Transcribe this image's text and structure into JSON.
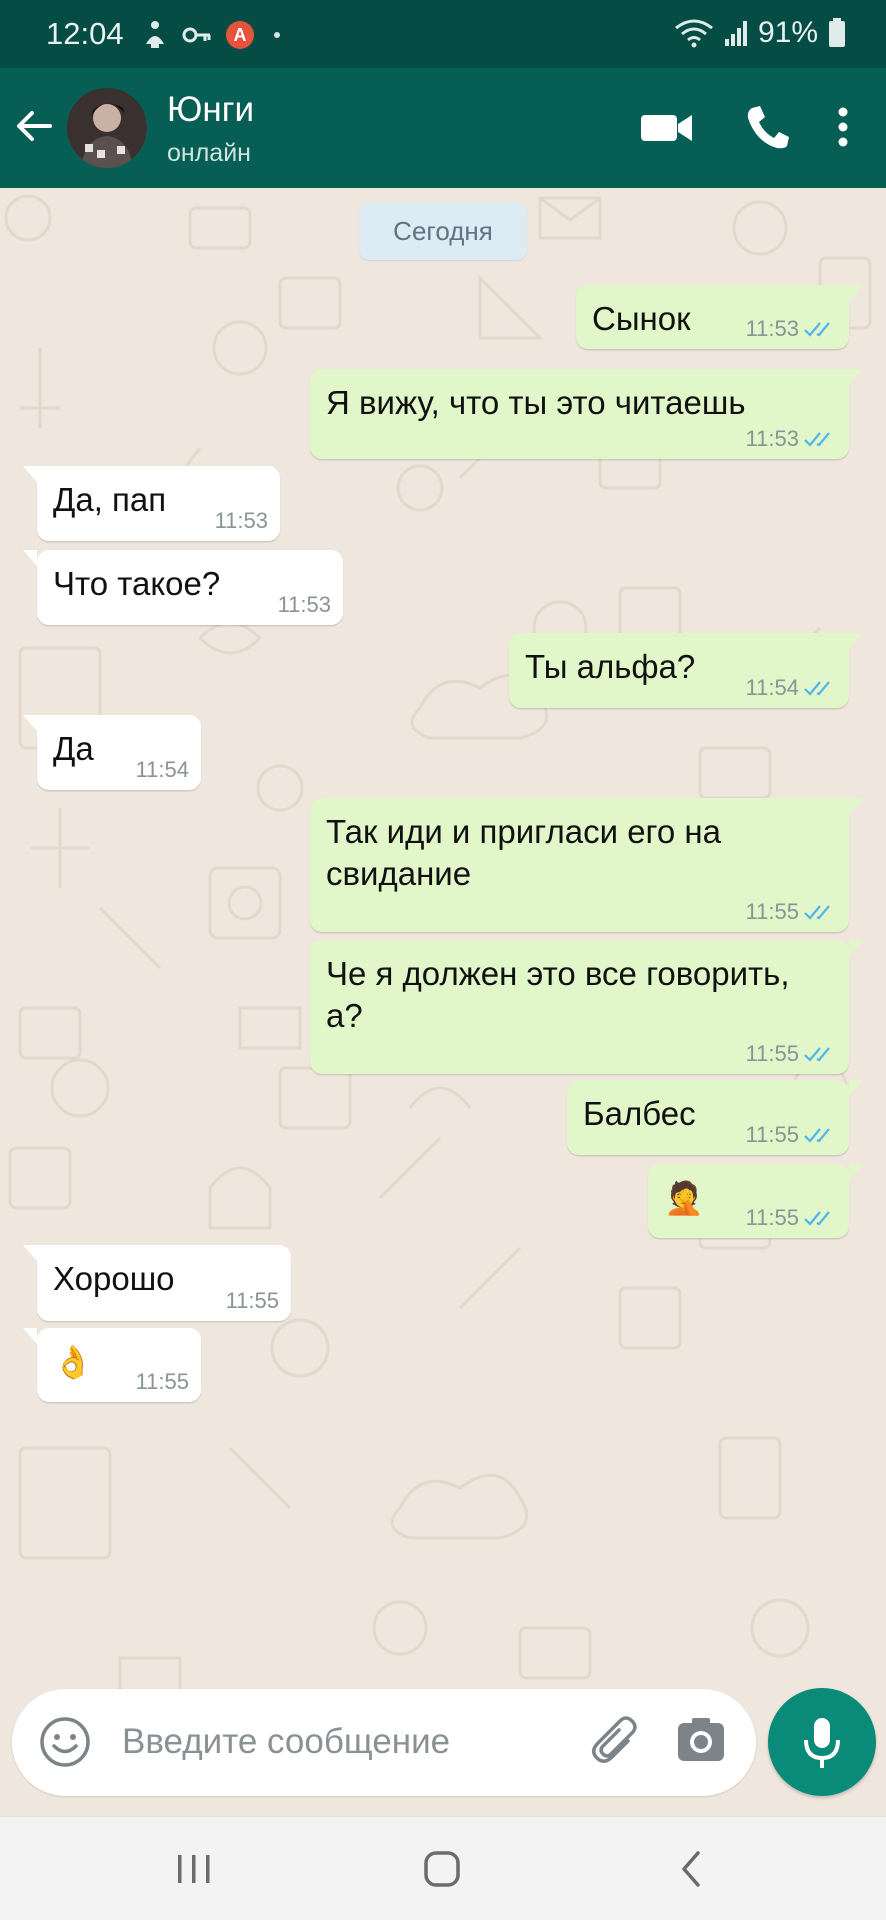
{
  "status_bar": {
    "time": "12:04",
    "battery": "91%",
    "badge_letter": "A",
    "icons": [
      "accessibility-icon",
      "key-icon",
      "app-badge-icon",
      "dot-icon",
      "wifi-icon",
      "signal-icon",
      "battery-icon"
    ]
  },
  "header": {
    "contact_name": "Юнги",
    "contact_status": "онлайн",
    "header_color": "#075e54",
    "icons": [
      "back-arrow-icon",
      "video-call-icon",
      "phone-icon",
      "more-vertical-icon"
    ]
  },
  "chat": {
    "date_label": "Сегодня",
    "outgoing_bubble_color": "#e1f6c9",
    "incoming_bubble_color": "#ffffff",
    "tick_color": "#4fb6ec",
    "messages": [
      {
        "direction": "out",
        "text": "Сынок",
        "time": "11:53",
        "status": "read"
      },
      {
        "direction": "out",
        "text": "Я вижу, что ты это читаешь",
        "time": "11:53",
        "status": "read"
      },
      {
        "direction": "in",
        "text": "Да, пап",
        "time": "11:53"
      },
      {
        "direction": "in",
        "text": "Что такое?",
        "time": "11:53"
      },
      {
        "direction": "out",
        "text": "Ты альфа?",
        "time": "11:54",
        "status": "read"
      },
      {
        "direction": "in",
        "text": "Да",
        "time": "11:54"
      },
      {
        "direction": "out",
        "text": "Так иди и пригласи его на свидание",
        "time": "11:55",
        "status": "read"
      },
      {
        "direction": "out",
        "text": "Че я должен это все говорить, а?",
        "time": "11:55",
        "status": "read"
      },
      {
        "direction": "out",
        "text": "Балбес",
        "time": "11:55",
        "status": "read"
      },
      {
        "direction": "out",
        "text": "🤦",
        "time": "11:55",
        "status": "read",
        "emoji": "facepalm"
      },
      {
        "direction": "in",
        "text": "Хорошо",
        "time": "11:55"
      },
      {
        "direction": "in",
        "text": "👌",
        "time": "11:55",
        "emoji": "ok-hand"
      }
    ]
  },
  "input_bar": {
    "placeholder": "Введите сообщение",
    "value": "",
    "icons": [
      "emoji-icon",
      "attach-icon",
      "camera-icon",
      "mic-icon"
    ],
    "mic_button_color": "#0a8a78"
  },
  "nav_bar": {
    "icons": [
      "recents-icon",
      "home-icon",
      "back-icon"
    ]
  }
}
